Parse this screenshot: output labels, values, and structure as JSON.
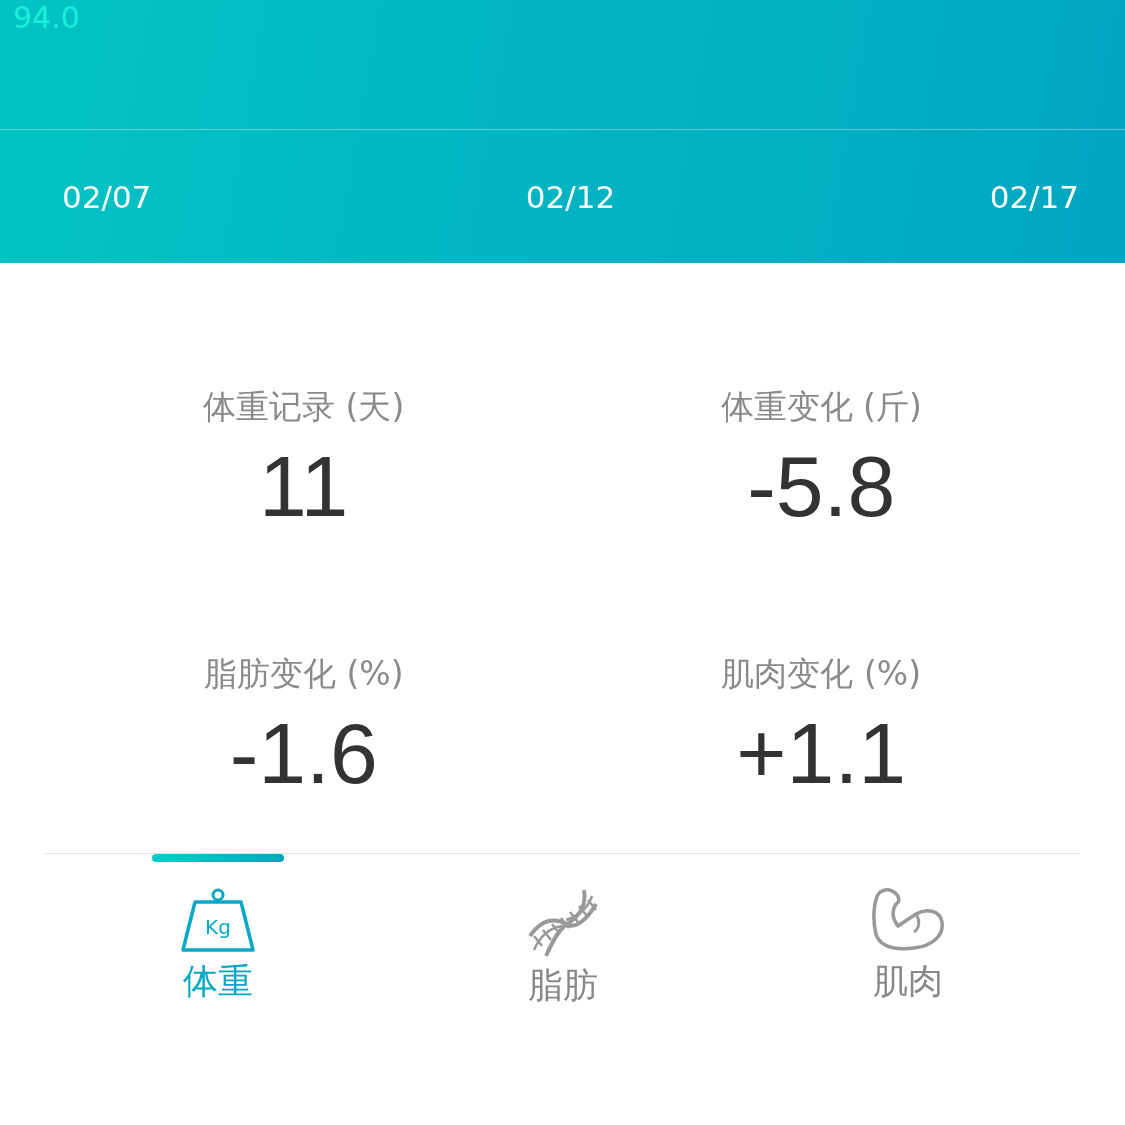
{
  "chart_header": {
    "axis_value": "94.0",
    "dates": [
      "02/07",
      "02/12",
      "02/17"
    ]
  },
  "stats": [
    {
      "label": "体重记录 (天)",
      "value": "11"
    },
    {
      "label": "体重变化 (斤)",
      "value": "-5.8"
    },
    {
      "label": "脂肪变化 (%)",
      "value": "-1.6"
    },
    {
      "label": "肌肉变化 (%)",
      "value": "+1.1"
    }
  ],
  "tabs": [
    {
      "kind": "weight",
      "icon_text": "Kg",
      "label": "体重",
      "selected": true
    },
    {
      "kind": "dna",
      "label": "脂肪",
      "selected": false
    },
    {
      "kind": "muscle",
      "label": "肌肉",
      "selected": false
    }
  ]
}
